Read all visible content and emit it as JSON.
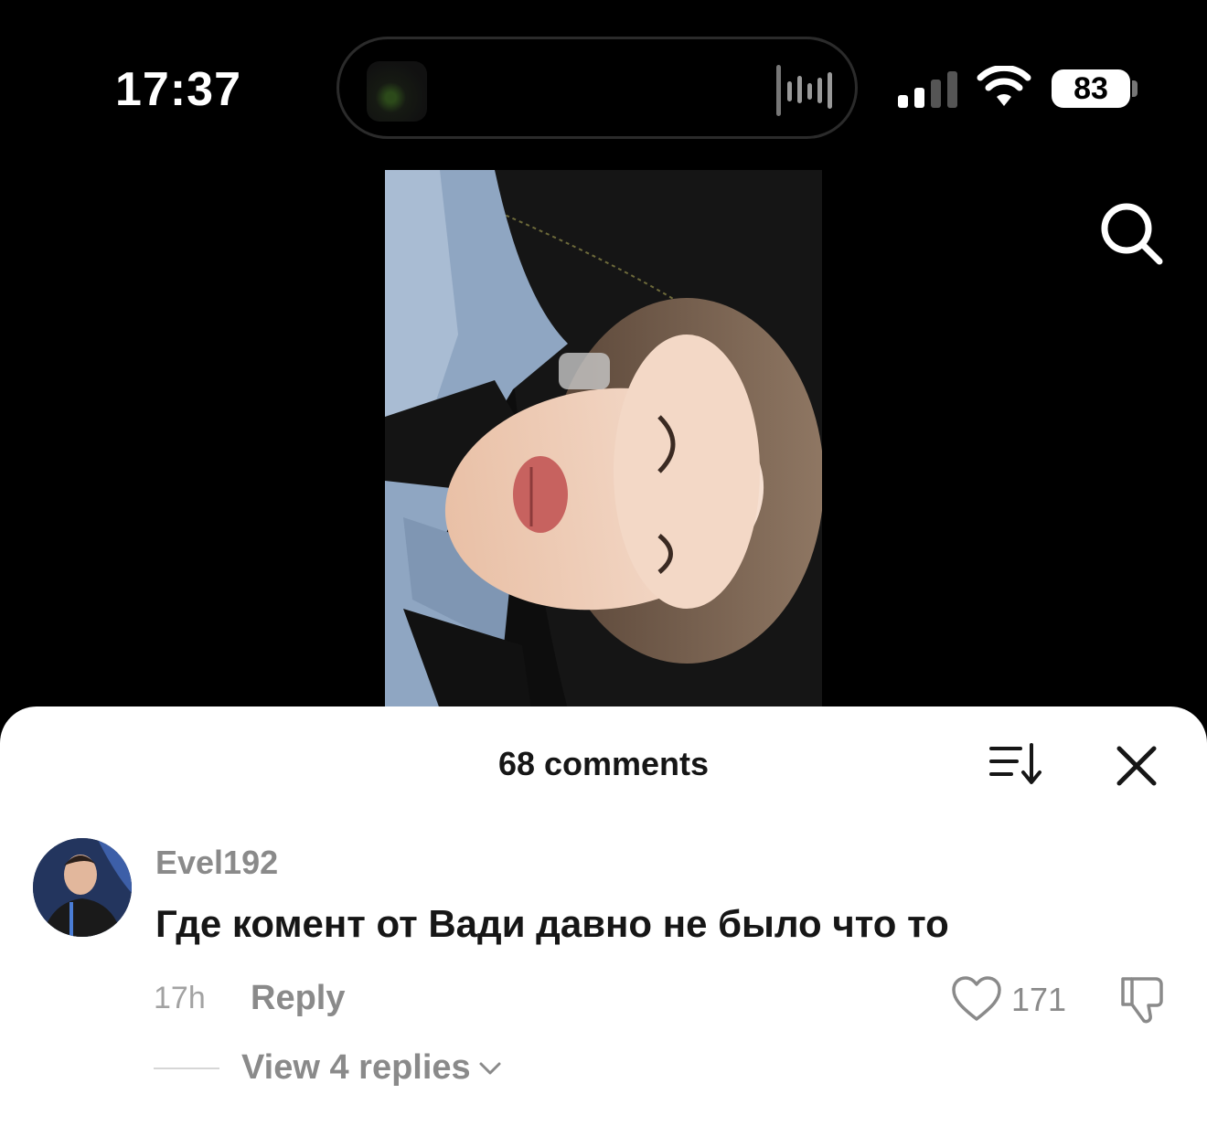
{
  "status_bar": {
    "time": "17:37",
    "battery": "83"
  },
  "icons": {
    "search": "search-icon",
    "sort": "sort-icon",
    "close": "close-icon",
    "like": "heart-icon",
    "dislike": "thumbs-down-icon",
    "chevron": "chevron-down-icon"
  },
  "comments_sheet": {
    "title": "68 comments",
    "comments": [
      {
        "username": "Evel192",
        "text": "Где комент от Вади давно не было что то",
        "time": "17h",
        "reply_label": "Reply",
        "likes": "171",
        "view_replies_label": "View 4 replies"
      }
    ]
  },
  "colors": {
    "background": "#000000",
    "sheet": "#ffffff",
    "muted_text": "#8a8a8a",
    "primary_text": "#161616"
  }
}
